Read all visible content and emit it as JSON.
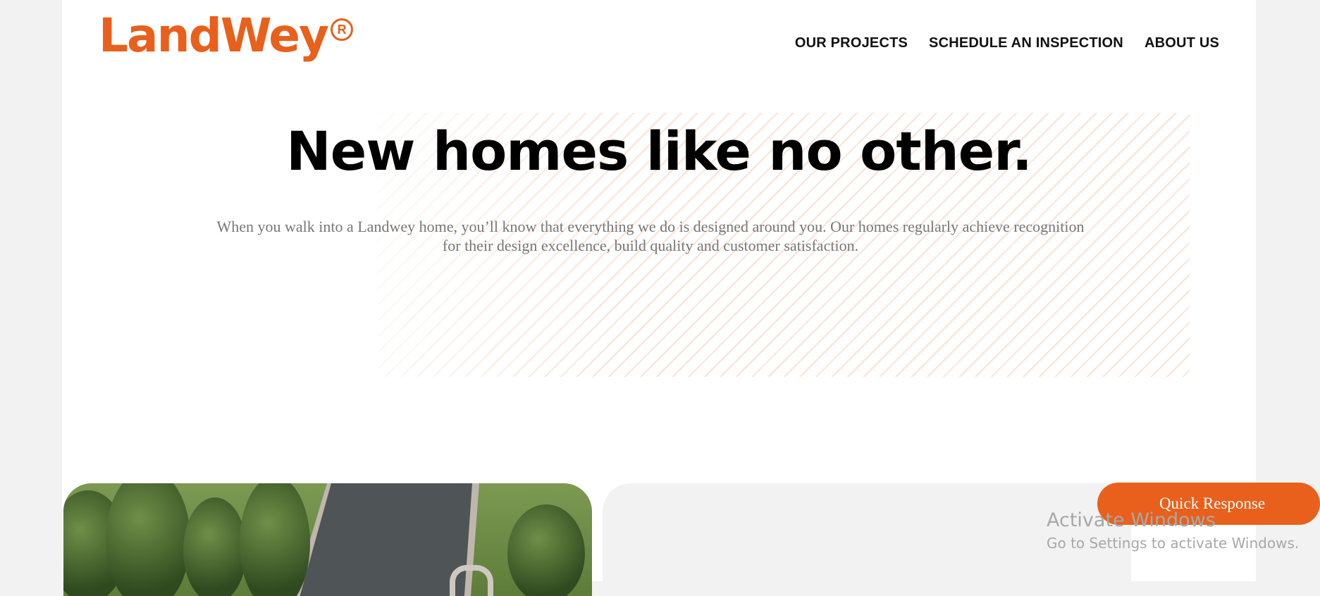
{
  "header": {
    "logo_text": "LandWey",
    "logo_reg": "R",
    "nav": [
      {
        "label": "OUR PROJECTS"
      },
      {
        "label": "SCHEDULE AN INSPECTION"
      },
      {
        "label": "ABOUT US"
      }
    ]
  },
  "hero": {
    "title": "New homes like no other.",
    "description": "When you walk into a Landwey home, you’ll know that everything we do is designed around you. Our homes regularly achieve recognition for their design excellence, build quality and customer satisfaction."
  },
  "quick_response": {
    "label": "Quick Response"
  },
  "windows_watermark": {
    "line1": "Activate Windows",
    "line2": "Go to Settings to activate Windows."
  },
  "colors": {
    "brand": "#e8601c",
    "background": "#f2f2f2"
  }
}
